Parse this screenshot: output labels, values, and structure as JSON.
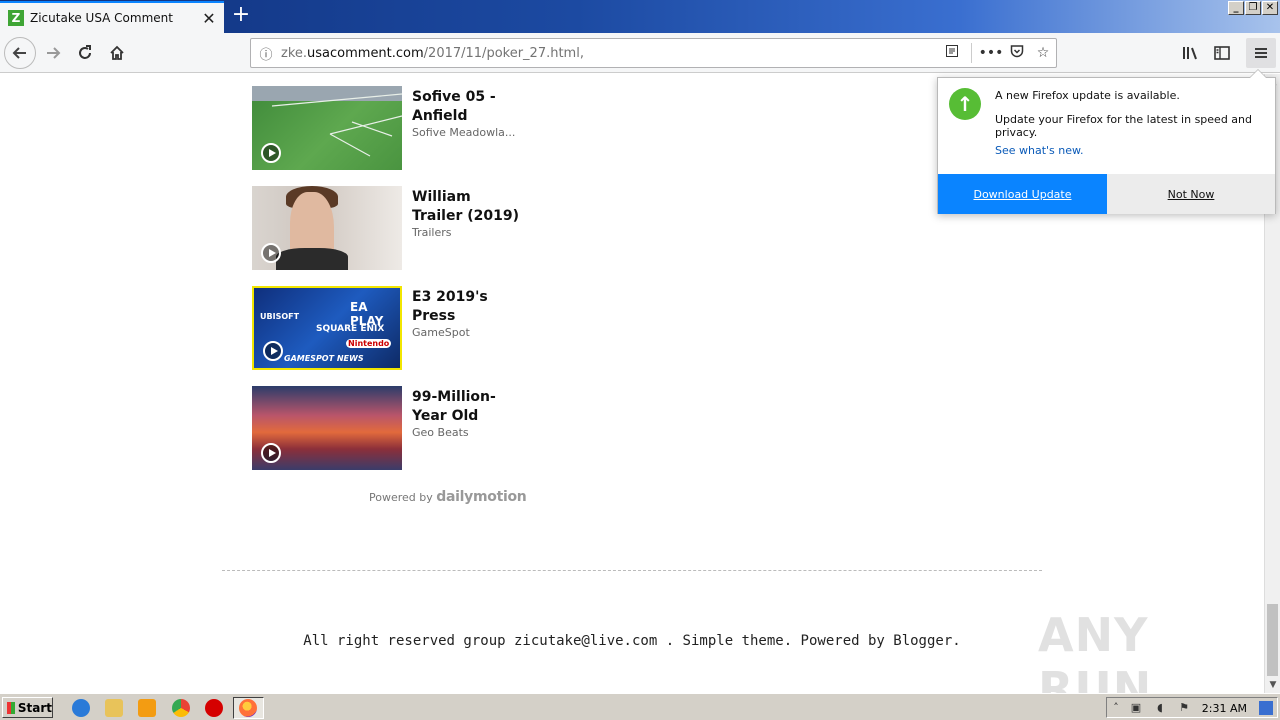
{
  "browser": {
    "tab_title": "Zicutake USA Comment",
    "tab_favicon_letter": "Z",
    "tab_close": "✕",
    "new_tab": "+",
    "url_prefix": "zke.",
    "url_domain": "usacomment.com",
    "url_path": "/2017/11/poker_27.html,",
    "icons": [
      "back-arrow-icon",
      "forward-arrow-icon",
      "reload-icon",
      "home-icon",
      "info-icon",
      "reader-view-icon",
      "more-actions-icon",
      "pocket-icon",
      "bookmark-star-icon",
      "library-icon",
      "sidebar-icon",
      "hamburger-menu-icon"
    ]
  },
  "videos": [
    {
      "title": "Sofive 05 - Anfield",
      "source": "Sofive Meadowla..."
    },
    {
      "title": "William Trailer (2019)",
      "source": "Trailers"
    },
    {
      "title": "E3 2019's Press",
      "source": "GameSpot"
    },
    {
      "title": "99-Million-Year Old",
      "source": "Geo Beats"
    }
  ],
  "thumb3_labels": {
    "a": "UBISOFT",
    "b": "EA PLAY",
    "c": "SQUARE ENIX",
    "d": "Nintendo",
    "e": "GAMESPOT NEWS"
  },
  "powered": {
    "prefix": "Powered by",
    "brand": "dailymotion"
  },
  "footer": "All right reserved group zicutake@live.com . Simple theme. Powered by Blogger.",
  "watermark": "ANY RUN",
  "update_panel": {
    "heading": "A new Firefox update is available.",
    "body": "Update your Firefox for the latest in speed and privacy.",
    "link": "See what's new.",
    "primary_button": "Download Update",
    "secondary_button": "Not Now",
    "accent": "#0a84ff",
    "icon_color": "#57bd35"
  },
  "taskbar": {
    "start": "Start",
    "clock": "2:31 AM"
  }
}
